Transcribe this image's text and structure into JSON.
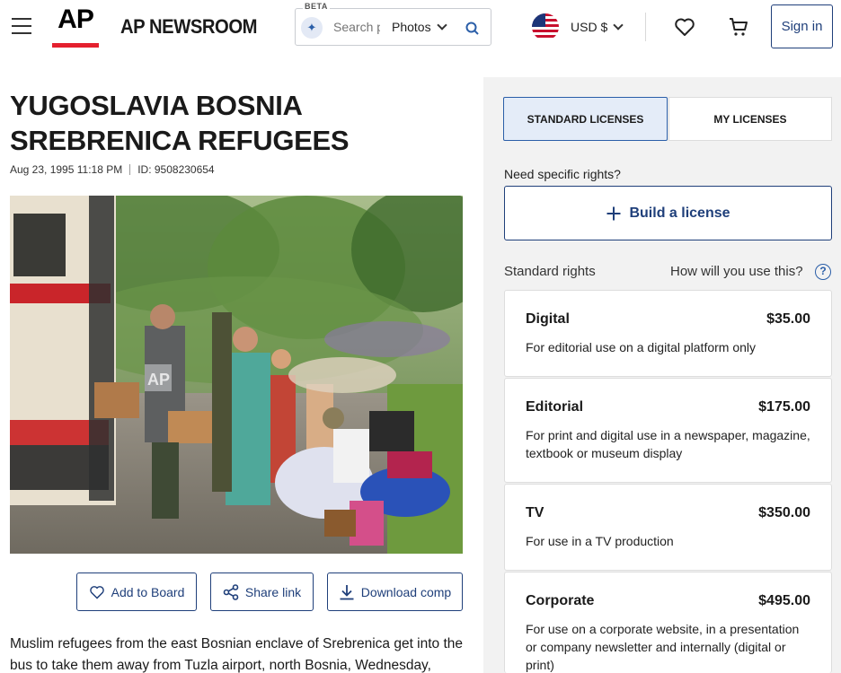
{
  "header": {
    "brand": "AP NEWSROOM",
    "logo_text": "AP",
    "search": {
      "beta_label": "BETA",
      "placeholder": "Search p",
      "type_value": "Photos"
    },
    "currency": "USD $",
    "sign_in": "Sign in",
    "icons": [
      "menu-icon",
      "sparkle-icon",
      "search-icon",
      "us-flag-icon",
      "heart-icon",
      "cart-icon"
    ]
  },
  "article": {
    "title": "YUGOSLAVIA BOSNIA SREBRENICA REFUGEES",
    "date": "Aug 23, 1995 11:18 PM",
    "id": "ID: 9508230654",
    "photo_watermark": "AP",
    "caption": "Muslim refugees from the east Bosnian enclave of Srebrenica get into the bus to take them away from Tuzla airport, north Bosnia, Wednesday,"
  },
  "actions": {
    "add_to_board": "Add to Board",
    "share_link": "Share link",
    "download_comp": "Download comp"
  },
  "licensing": {
    "tabs": [
      {
        "label": "STANDARD LICENSES",
        "active": true
      },
      {
        "label": "MY LICENSES",
        "active": false
      }
    ],
    "need_rights": "Need specific rights?",
    "build_license": "Build a license",
    "standard_rights": "Standard rights",
    "how_use": "How will you use this?",
    "licenses": [
      {
        "name": "Digital",
        "price": "$35.00",
        "desc": "For editorial use on a digital platform only"
      },
      {
        "name": "Editorial",
        "price": "$175.00",
        "desc": "For print and digital use in a newspaper, magazine, textbook or museum display"
      },
      {
        "name": "TV",
        "price": "$350.00",
        "desc": "For use in a TV production"
      },
      {
        "name": "Corporate",
        "price": "$495.00",
        "desc": "For use on a corporate website, in a presentation or company newsletter and internally (digital or print)"
      }
    ]
  },
  "colors": {
    "accent": "#1f3f7a",
    "ap_red": "#e4202e",
    "panel_bg": "#f2f2f2",
    "active_tab_bg": "#e4ecf8"
  }
}
